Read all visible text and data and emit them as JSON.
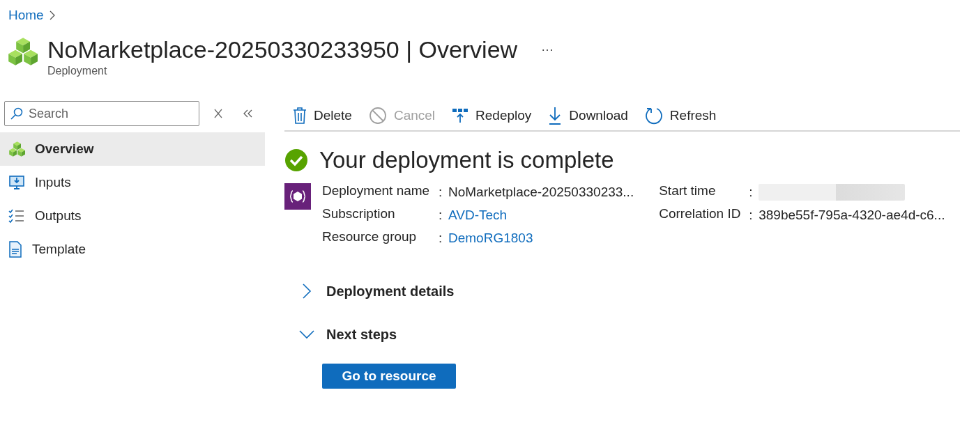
{
  "breadcrumb": [
    {
      "label": "Home"
    }
  ],
  "header": {
    "title": "NoMarketplace-20250330233950 | Overview",
    "subtitle": "Deployment",
    "more": "···"
  },
  "sidebar": {
    "search": {
      "placeholder": "Search"
    },
    "items": [
      {
        "label": "Overview",
        "selected": true
      },
      {
        "label": "Inputs",
        "selected": false
      },
      {
        "label": "Outputs",
        "selected": false
      },
      {
        "label": "Template",
        "selected": false
      }
    ]
  },
  "toolbar": [
    {
      "label": "Delete",
      "disabled": false
    },
    {
      "label": "Cancel",
      "disabled": true
    },
    {
      "label": "Redeploy",
      "disabled": false
    },
    {
      "label": "Download",
      "disabled": false
    },
    {
      "label": "Refresh",
      "disabled": false
    }
  ],
  "status": {
    "heading": "Your deployment is complete"
  },
  "details": {
    "left": [
      {
        "label": "Deployment name",
        "separator": ":",
        "kind": "text",
        "value": "NoMarketplace-20250330233..."
      },
      {
        "label": "Subscription",
        "separator": ":",
        "kind": "link",
        "value": "AVD-Tech"
      },
      {
        "label": "Resource group",
        "separator": ":",
        "kind": "link",
        "value": "DemoRG1803"
      }
    ],
    "right": [
      {
        "label": "Start time",
        "separator": ":",
        "kind": "redacted"
      },
      {
        "label": "Correlation ID",
        "separator": ":",
        "kind": "text",
        "value": "389be55f-795a-4320-ae4d-c6..."
      }
    ]
  },
  "sections": [
    {
      "label": "Deployment details",
      "expanded": false
    },
    {
      "label": "Next steps",
      "expanded": true
    }
  ],
  "primary_button": {
    "label": "Go to resource"
  }
}
